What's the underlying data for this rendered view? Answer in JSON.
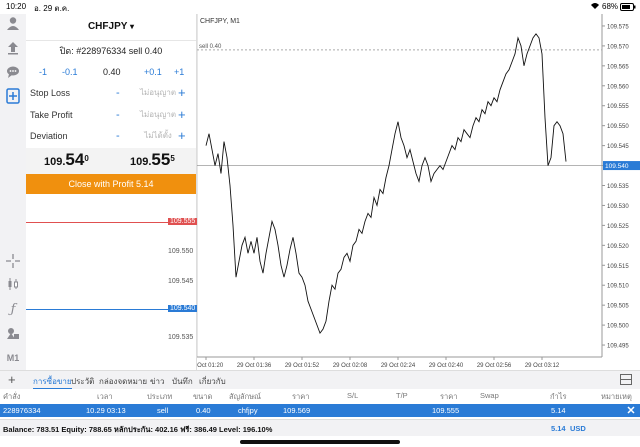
{
  "status_bar": {
    "time": "10:20",
    "date": "อ. 29 ต.ค.",
    "battery": "68%"
  },
  "left_toolbar": {
    "icons": [
      "user-icon",
      "upload-icon",
      "chat-icon",
      "new-order-icon",
      "crosshair-icon",
      "candles-icon",
      "function-icon",
      "objects-icon",
      "timeframe-icon"
    ],
    "timeframe_label": "M1"
  },
  "order_panel": {
    "symbol": "CHFJPY",
    "symbol_caret": "▾",
    "order_title": "ปิด: #228976334 sell 0.40",
    "step_buttons": [
      "-1",
      "-0.1",
      "0.40",
      "+0.1",
      "+1"
    ],
    "stop_loss": {
      "label": "Stop Loss",
      "value": "ไม่อนุญาต"
    },
    "take_profit": {
      "label": "Take Profit",
      "value": "ไม่อนุญาต"
    },
    "deviation": {
      "label": "Deviation",
      "value": "ไม่ได้ตั้ง"
    },
    "bid": {
      "small": "109.",
      "big": "54",
      "sup": "0"
    },
    "ask": {
      "small": "109.",
      "big": "55",
      "sup": "5"
    },
    "close_button": "Close with Profit 5.14",
    "minus_sign": "-",
    "plus_sign": "+"
  },
  "depth": {
    "levels": [
      {
        "price": "109.555",
        "color": "#e05050",
        "highlight": true
      },
      {
        "price": "109.550",
        "highlight": false
      },
      {
        "price": "109.545",
        "highlight": false
      },
      {
        "price": "109.540",
        "color": "#2a7bd6",
        "highlight": true
      },
      {
        "price": "109.535",
        "highlight": false
      }
    ]
  },
  "chart_data": {
    "type": "line",
    "title": "CHFJPY, M1",
    "order_line_label": "sell 0.40",
    "order_price": 109.569,
    "current_price": 109.54,
    "current_price_label": "109.540",
    "ylim": [
      109.492,
      109.578
    ],
    "y_ticks": [
      "109.575",
      "109.570",
      "109.565",
      "109.560",
      "109.555",
      "109.550",
      "109.545",
      "109.540",
      "109.535",
      "109.530",
      "109.525",
      "109.520",
      "109.515",
      "109.510",
      "109.505",
      "109.500",
      "109.495"
    ],
    "x_ticks": [
      "29 Oct 01:20",
      "29 Oct 01:36",
      "29 Oct 01:52",
      "29 Oct 02:08",
      "29 Oct 02:24",
      "29 Oct 02:40",
      "29 Oct 02:56",
      "29 Oct 03:12"
    ],
    "x_range": [
      -3,
      132
    ],
    "series": [
      {
        "values": [
          [
            0,
            109.545
          ],
          [
            1,
            109.548
          ],
          [
            2,
            109.544
          ],
          [
            3,
            109.54
          ],
          [
            4,
            109.543
          ],
          [
            5,
            109.538
          ],
          [
            6,
            109.546
          ],
          [
            7,
            109.542
          ],
          [
            8,
            109.535
          ],
          [
            9,
            109.525
          ],
          [
            10,
            109.512
          ],
          [
            11,
            109.516
          ],
          [
            12,
            109.52
          ],
          [
            13,
            109.522
          ],
          [
            14,
            109.518
          ],
          [
            15,
            109.521
          ],
          [
            16,
            109.518
          ],
          [
            17,
            109.522
          ],
          [
            18,
            109.516
          ],
          [
            19,
            109.513
          ],
          [
            20,
            109.518
          ],
          [
            21,
            109.522
          ],
          [
            22,
            109.526
          ],
          [
            23,
            109.524
          ],
          [
            24,
            109.52
          ],
          [
            25,
            109.515
          ],
          [
            26,
            109.512
          ],
          [
            27,
            109.515
          ],
          [
            28,
            109.519
          ],
          [
            29,
            109.522
          ],
          [
            30,
            109.518
          ],
          [
            31,
            109.513
          ],
          [
            32,
            109.512
          ],
          [
            33,
            109.51
          ],
          [
            34,
            109.506
          ],
          [
            35,
            109.504
          ],
          [
            36,
            109.502
          ],
          [
            37,
            109.5
          ],
          [
            38,
            109.498
          ],
          [
            39,
            109.499
          ],
          [
            40,
            109.501
          ],
          [
            41,
            109.506
          ],
          [
            42,
            109.51
          ],
          [
            43,
            109.509
          ],
          [
            44,
            109.513
          ],
          [
            45,
            109.514
          ],
          [
            46,
            109.517
          ],
          [
            47,
            109.518
          ],
          [
            48,
            109.516
          ],
          [
            49,
            109.52
          ],
          [
            50,
            109.521
          ],
          [
            51,
            109.524
          ],
          [
            52,
            109.523
          ],
          [
            53,
            109.526
          ],
          [
            54,
            109.528
          ],
          [
            55,
            109.527
          ],
          [
            56,
            109.532
          ],
          [
            57,
            109.53
          ],
          [
            58,
            109.534
          ],
          [
            59,
            109.533
          ],
          [
            60,
            109.537
          ],
          [
            61,
            109.54
          ],
          [
            62,
            109.544
          ],
          [
            63,
            109.548
          ],
          [
            64,
            109.551
          ],
          [
            65,
            109.547
          ],
          [
            66,
            109.545
          ],
          [
            67,
            109.542
          ],
          [
            68,
            109.544
          ],
          [
            69,
            109.541
          ],
          [
            70,
            109.538
          ],
          [
            71,
            109.536
          ],
          [
            72,
            109.54
          ],
          [
            73,
            109.542
          ],
          [
            74,
            109.54
          ],
          [
            75,
            109.536
          ],
          [
            76,
            109.538
          ],
          [
            77,
            109.539
          ],
          [
            78,
            109.54
          ],
          [
            79,
            109.539
          ],
          [
            80,
            109.541
          ],
          [
            81,
            109.543
          ],
          [
            82,
            109.545
          ],
          [
            83,
            109.544
          ],
          [
            84,
            109.547
          ],
          [
            85,
            109.546
          ],
          [
            86,
            109.549
          ],
          [
            87,
            109.548
          ],
          [
            88,
            109.547
          ],
          [
            89,
            109.55
          ],
          [
            90,
            109.552
          ],
          [
            91,
            109.551
          ],
          [
            92,
            109.554
          ],
          [
            93,
            109.553
          ],
          [
            94,
            109.556
          ],
          [
            95,
            109.555
          ],
          [
            96,
            109.557
          ],
          [
            97,
            109.556
          ],
          [
            98,
            109.559
          ],
          [
            99,
            109.561
          ],
          [
            100,
            109.563
          ],
          [
            101,
            109.564
          ],
          [
            102,
            109.566
          ],
          [
            103,
            109.568
          ],
          [
            104,
            109.572
          ],
          [
            105,
            109.57
          ],
          [
            106,
            109.565
          ],
          [
            107,
            109.568
          ],
          [
            108,
            109.57
          ],
          [
            109,
            109.572
          ],
          [
            110,
            109.573
          ],
          [
            111,
            109.572
          ],
          [
            112,
            109.568
          ],
          [
            113,
            109.552
          ],
          [
            114,
            109.54
          ],
          [
            115,
            109.542
          ],
          [
            116,
            109.55
          ],
          [
            117,
            109.551
          ],
          [
            118,
            109.55
          ],
          [
            119,
            109.548
          ],
          [
            120,
            109.541
          ]
        ]
      }
    ]
  },
  "bottom_toolbar": {
    "plus": "+",
    "tabs": [
      "การซื้อขาย",
      "ประวัติ",
      "กล่องจดหมาย",
      "ข่าว",
      "บันทึก",
      "เกี่ยวกับ"
    ]
  },
  "trade_table": {
    "headers": [
      "คำสั่ง",
      "เวลา",
      "ประเภท",
      "ขนาด",
      "สัญลักษณ์",
      "ราคา",
      "S/L",
      "T/P",
      "ราคา",
      "Swap",
      "กำไร",
      "หมายเหตุ"
    ],
    "rows": [
      [
        "228976334",
        "10.29 03:13",
        "sell",
        "0.40",
        "chfjpy",
        "109.569",
        "",
        "",
        "109.555",
        "",
        "5.14",
        ""
      ]
    ]
  },
  "balance_bar": {
    "summary": "Balance: 783.51  Equity: 788.65  หลักประกัน: 402.16  ฟรี: 386.49  Level: 196.10%",
    "profit": "5.14",
    "currency": "USD"
  }
}
